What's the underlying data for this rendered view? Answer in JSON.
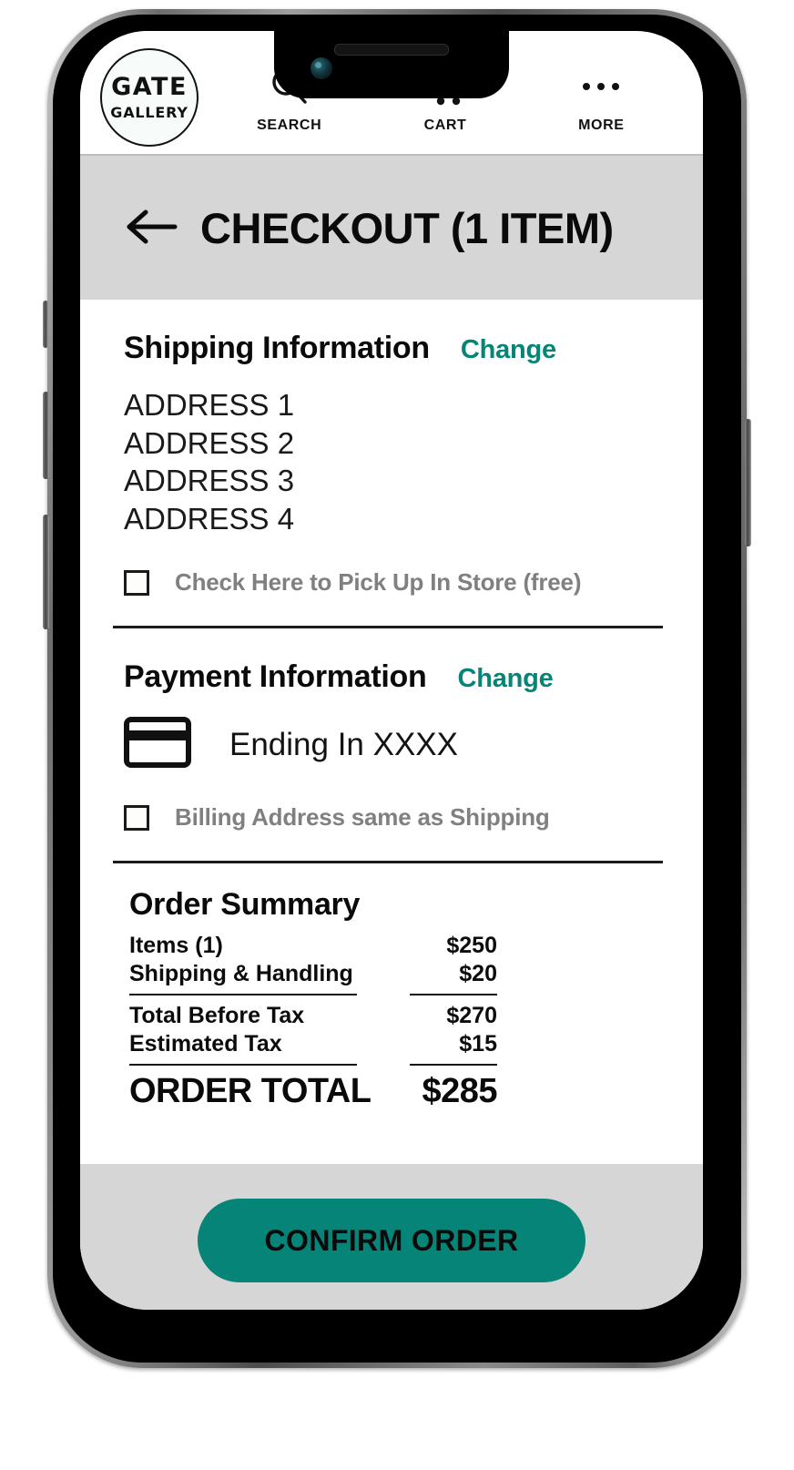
{
  "app": {
    "logo": {
      "main": "GATE",
      "sub": "GALLERY"
    },
    "nav": [
      {
        "label": "SEARCH",
        "icon": "search-icon"
      },
      {
        "label": "CART",
        "icon": "cart-icon"
      },
      {
        "label": "MORE",
        "icon": "more-dots-icon"
      }
    ]
  },
  "title_bar": {
    "back_icon": "back-arrow-icon",
    "title": "CHECKOUT (1 ITEM)"
  },
  "shipping": {
    "heading": "Shipping Information",
    "change_label": "Change",
    "address": [
      "ADDRESS 1",
      "ADDRESS 2",
      "ADDRESS 3",
      "ADDRESS 4"
    ],
    "pickup_checkbox_label": "Check Here to Pick Up In Store (free)",
    "pickup_checked": false
  },
  "payment": {
    "heading": "Payment Information",
    "change_label": "Change",
    "card_icon": "credit-card-icon",
    "card_text": "Ending In XXXX",
    "billing_checkbox_label": "Billing Address same as Shipping",
    "billing_checked": false
  },
  "order_summary": {
    "heading": "Order Summary",
    "rows": [
      {
        "label": "Items (1)",
        "value": "$250"
      },
      {
        "label": "Shipping & Handling",
        "value": "$20"
      }
    ],
    "rows2": [
      {
        "label": "Total Before Tax",
        "value": "$270"
      },
      {
        "label": "Estimated Tax",
        "value": "$15"
      }
    ],
    "total": {
      "label": "ORDER TOTAL",
      "value": "$285"
    }
  },
  "bottom": {
    "confirm_label": "CONFIRM ORDER"
  },
  "colors": {
    "accent": "#058477",
    "bar_gray": "#d6d6d6",
    "muted_text": "#808080"
  }
}
